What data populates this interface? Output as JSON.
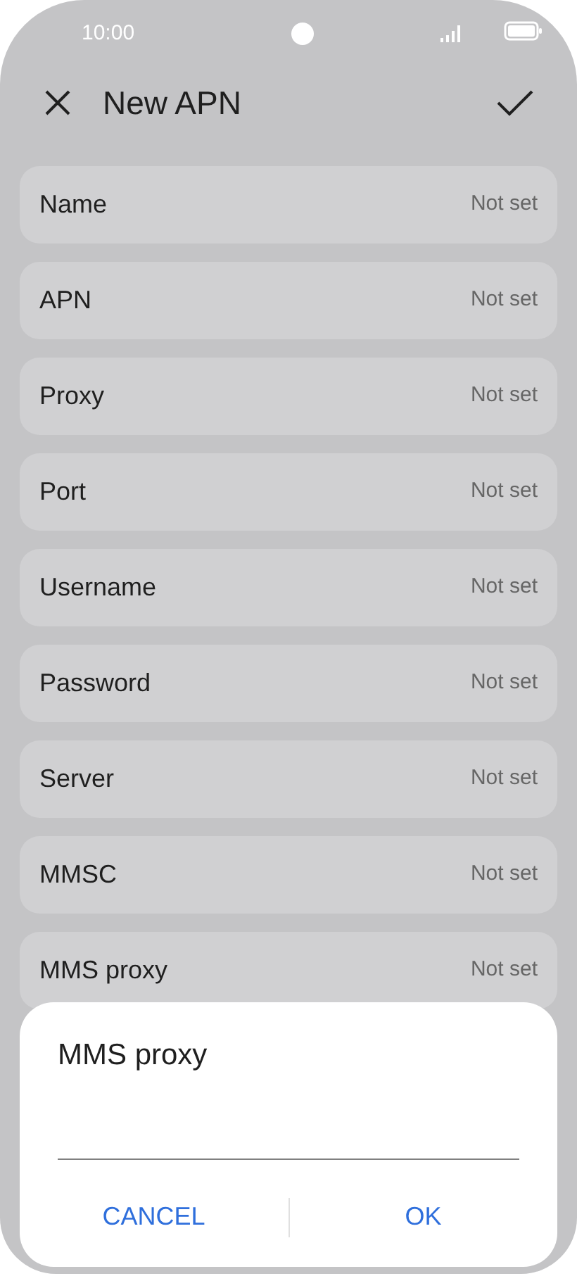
{
  "status_bar": {
    "time": "10:00"
  },
  "header": {
    "title": "New APN"
  },
  "settings": [
    {
      "label": "Name",
      "value": "Not set"
    },
    {
      "label": "APN",
      "value": "Not set"
    },
    {
      "label": "Proxy",
      "value": "Not set"
    },
    {
      "label": "Port",
      "value": "Not set"
    },
    {
      "label": "Username",
      "value": "Not set"
    },
    {
      "label": "Password",
      "value": "Not set"
    },
    {
      "label": "Server",
      "value": "Not set"
    },
    {
      "label": "MMSC",
      "value": "Not set"
    },
    {
      "label": "MMS proxy",
      "value": "Not set"
    }
  ],
  "dialog": {
    "title": "MMS proxy",
    "buttons": [
      "CANCEL",
      "OK"
    ]
  }
}
